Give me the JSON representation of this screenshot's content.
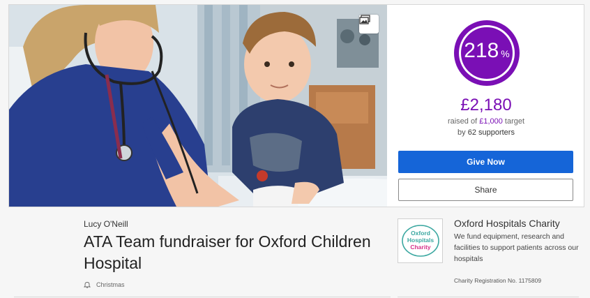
{
  "hero": {
    "gallery_icon": "image-gallery-icon"
  },
  "progress": {
    "percent": "218",
    "percent_sign": "%",
    "percent_value": 218,
    "ring_color": "#7a0fb5"
  },
  "funds": {
    "raised": "£2,180",
    "raised_of": "raised of",
    "target": "£1,000",
    "target_suffix": "target",
    "by": "by",
    "supporters": "62 supporters"
  },
  "actions": {
    "give_label": "Give Now",
    "share_label": "Share",
    "give_color": "#1565d8"
  },
  "page": {
    "author": "Lucy O'Neill",
    "title": "ATA Team fundraiser for Oxford Children Hospital",
    "event_icon": "bell-icon",
    "event": "Christmas"
  },
  "charity": {
    "logo_text_1": "Oxford",
    "logo_text_2": "Hospitals",
    "logo_text_3": "Charity",
    "name": "Oxford Hospitals Charity",
    "description": "We fund equipment, research and facilities to support patients across our hospitals",
    "registration": "Charity Registration No. 1175809"
  }
}
